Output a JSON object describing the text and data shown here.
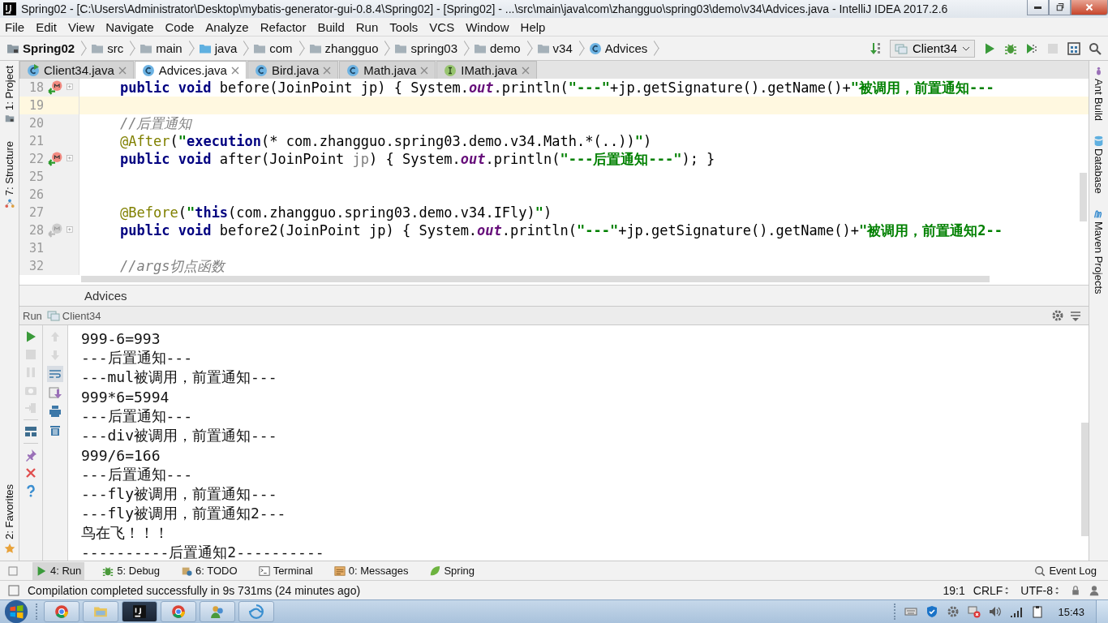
{
  "window": {
    "title": "Spring02 - [C:\\Users\\Administrator\\Desktop\\mybatis-generator-gui-0.8.4\\Spring02] - [Spring02] - ...\\src\\main\\java\\com\\zhangguo\\spring03\\demo\\v34\\Advices.java - IntelliJ IDEA 2017.2.6"
  },
  "menu": [
    "File",
    "Edit",
    "View",
    "Navigate",
    "Code",
    "Analyze",
    "Refactor",
    "Build",
    "Run",
    "Tools",
    "VCS",
    "Window",
    "Help"
  ],
  "breadcrumbs": [
    {
      "label": "Spring02",
      "kind": "project"
    },
    {
      "label": "src",
      "kind": "folder"
    },
    {
      "label": "main",
      "kind": "folder"
    },
    {
      "label": "java",
      "kind": "source"
    },
    {
      "label": "com",
      "kind": "folder"
    },
    {
      "label": "zhangguo",
      "kind": "folder"
    },
    {
      "label": "spring03",
      "kind": "folder"
    },
    {
      "label": "demo",
      "kind": "folder"
    },
    {
      "label": "v34",
      "kind": "folder"
    },
    {
      "label": "Advices",
      "kind": "class"
    }
  ],
  "run_config": {
    "label": "Client34"
  },
  "toolbar": [
    {
      "kind": "run",
      "disabled": false
    },
    {
      "kind": "debug",
      "disabled": false
    },
    {
      "kind": "coverage",
      "disabled": false
    },
    {
      "kind": "stop",
      "disabled": true
    },
    {
      "kind": "structure",
      "disabled": false
    },
    {
      "kind": "search",
      "disabled": false
    }
  ],
  "tabs": [
    {
      "label": "Client34.java",
      "kind": "class-run",
      "selected": false
    },
    {
      "label": "Advices.java",
      "kind": "class",
      "selected": true
    },
    {
      "label": "Bird.java",
      "kind": "class",
      "selected": false
    },
    {
      "label": "Math.java",
      "kind": "class",
      "selected": false
    },
    {
      "label": "IMath.java",
      "kind": "interface",
      "selected": false
    }
  ],
  "left_tools_top": [
    {
      "label": "1: Project",
      "kind": "project"
    },
    {
      "label": "7: Structure",
      "kind": "structure"
    }
  ],
  "left_tools_bottom": [
    {
      "label": "2: Favorites",
      "kind": "favorites"
    }
  ],
  "right_tools": [
    {
      "label": "Ant Build",
      "kind": "ant"
    },
    {
      "label": "Database",
      "kind": "database"
    },
    {
      "label": "Maven Projects",
      "kind": "maven"
    }
  ],
  "editor": {
    "lines": [
      {
        "number": "18",
        "marker": true,
        "current": false,
        "tokens": [
          {
            "text": "public void ",
            "kind": "kw"
          },
          {
            "text": "before(JoinPoint jp) { System.",
            "kind": "txt"
          },
          {
            "text": "out",
            "kind": "field"
          },
          {
            "text": ".println(",
            "kind": "txt"
          },
          {
            "text": "\"---\"",
            "kind": "str"
          },
          {
            "text": "+jp.getSignature().getName()+",
            "kind": "txt"
          },
          {
            "text": "\"被调用，前置通知---",
            "kind": "str"
          }
        ]
      },
      {
        "number": "19",
        "marker": false,
        "current": true
      },
      {
        "number": "20",
        "marker": false,
        "current": false,
        "tokens": [
          {
            "text": "//后置通知",
            "kind": "cmt"
          }
        ]
      },
      {
        "number": "21",
        "marker": false,
        "current": false,
        "tokens": [
          {
            "text": "@After",
            "kind": "ann"
          },
          {
            "text": "(",
            "kind": "txt"
          },
          {
            "text": "\"",
            "kind": "str"
          },
          {
            "text": "execution",
            "kind": "kw"
          },
          {
            "text": "(* com.zhangguo.spring03.demo.v34.Math.*(..))",
            "kind": "txt"
          },
          {
            "text": "\"",
            "kind": "str"
          },
          {
            "text": ")",
            "kind": "txt"
          }
        ]
      },
      {
        "number": "22",
        "marker": true,
        "current": false,
        "tokens": [
          {
            "text": "public void ",
            "kind": "kw"
          },
          {
            "text": "after(JoinPoint ",
            "kind": "txt"
          },
          {
            "text": "jp",
            "kind": "unused"
          },
          {
            "text": ") { System.",
            "kind": "txt"
          },
          {
            "text": "out",
            "kind": "field"
          },
          {
            "text": ".println(",
            "kind": "txt"
          },
          {
            "text": "\"---后置通知---\"",
            "kind": "str"
          },
          {
            "text": "); }",
            "kind": "txt"
          }
        ]
      },
      {
        "number": "25",
        "marker": false,
        "current": false
      },
      {
        "number": "26",
        "marker": false,
        "current": false
      },
      {
        "number": "27",
        "marker": false,
        "current": false,
        "tokens": [
          {
            "text": "@Before",
            "kind": "ann"
          },
          {
            "text": "(",
            "kind": "txt"
          },
          {
            "text": "\"",
            "kind": "str"
          },
          {
            "text": "this",
            "kind": "kw"
          },
          {
            "text": "(com.zhangguo.spring03.demo.v34.IFly)",
            "kind": "txt"
          },
          {
            "text": "\"",
            "kind": "str"
          },
          {
            "text": ")",
            "kind": "txt"
          }
        ]
      },
      {
        "number": "28",
        "marker": true,
        "current": false,
        "tokens": [
          {
            "text": "public void ",
            "kind": "kw"
          },
          {
            "text": "before2(JoinPoint jp) { System.",
            "kind": "txt"
          },
          {
            "text": "out",
            "kind": "field"
          },
          {
            "text": ".println(",
            "kind": "txt"
          },
          {
            "text": "\"---\"",
            "kind": "str"
          },
          {
            "text": "+jp.getSignature().getName()+",
            "kind": "txt"
          },
          {
            "text": "\"被调用，前置通知2--",
            "kind": "str"
          }
        ]
      },
      {
        "number": "31",
        "marker": false,
        "current": false
      },
      {
        "number": "32",
        "marker": false,
        "current": false,
        "tokens": [
          {
            "text": "//args切点函数",
            "kind": "cmt"
          }
        ]
      }
    ],
    "breadcrumb": "Advices"
  },
  "run_panel": {
    "title": "Run",
    "config": "Client34",
    "actions_left": [
      {
        "kind": "run",
        "disabled": false
      },
      {
        "kind": "stop",
        "disabled": true
      },
      {
        "kind": "pause",
        "disabled": true
      },
      {
        "kind": "camera",
        "disabled": true
      },
      {
        "kind": "exit",
        "disabled": true
      },
      {
        "kind": "layout",
        "disabled": false
      },
      {
        "kind": "pin",
        "disabled": false
      },
      {
        "kind": "close",
        "disabled": false
      },
      {
        "kind": "help",
        "disabled": false
      }
    ],
    "actions_right": [
      {
        "kind": "up",
        "disabled": true
      },
      {
        "kind": "down",
        "disabled": true
      },
      {
        "kind": "wrap",
        "disabled": false
      },
      {
        "kind": "scroll-end",
        "disabled": false
      },
      {
        "kind": "print",
        "disabled": false
      },
      {
        "kind": "trash",
        "disabled": false
      }
    ],
    "output": [
      "999-6=993",
      "---后置通知---",
      "---mul被调用，前置通知---",
      "999*6=5994",
      "---后置通知---",
      "---div被调用，前置通知---",
      "999/6=166",
      "---后置通知---",
      "---fly被调用，前置通知---",
      "---fly被调用，前置通知2---",
      "鸟在飞！！！",
      "----------后置通知2----------"
    ]
  },
  "bottom_tabs": [
    {
      "label": "4: Run",
      "kind": "run",
      "selected": true
    },
    {
      "label": "5: Debug",
      "kind": "debug",
      "selected": false
    },
    {
      "label": "6: TODO",
      "kind": "todo",
      "selected": false
    },
    {
      "label": "Terminal",
      "kind": "terminal",
      "selected": false
    },
    {
      "label": "0: Messages",
      "kind": "messages",
      "selected": false
    },
    {
      "label": "Spring",
      "kind": "spring",
      "selected": false
    }
  ],
  "event_log": "Event Log",
  "status_bar": {
    "message": "Compilation completed successfully in 9s 731ms (24 minutes ago)",
    "position": "19:1",
    "line_separator": "CRLF",
    "encoding": "UTF-8"
  },
  "taskbar": {
    "apps": [
      {
        "kind": "chrome",
        "active": false
      },
      {
        "kind": "explorer",
        "active": false
      },
      {
        "kind": "intellij",
        "active": true
      },
      {
        "kind": "chrome",
        "active": false
      },
      {
        "kind": "people",
        "active": false
      },
      {
        "kind": "swirl",
        "active": false
      }
    ],
    "tray": [
      {
        "kind": "keyboard"
      },
      {
        "kind": "shield"
      },
      {
        "kind": "gear"
      },
      {
        "kind": "network"
      },
      {
        "kind": "speaker"
      },
      {
        "kind": "signal"
      },
      {
        "kind": "clipboard"
      }
    ],
    "clock": "15:43"
  }
}
